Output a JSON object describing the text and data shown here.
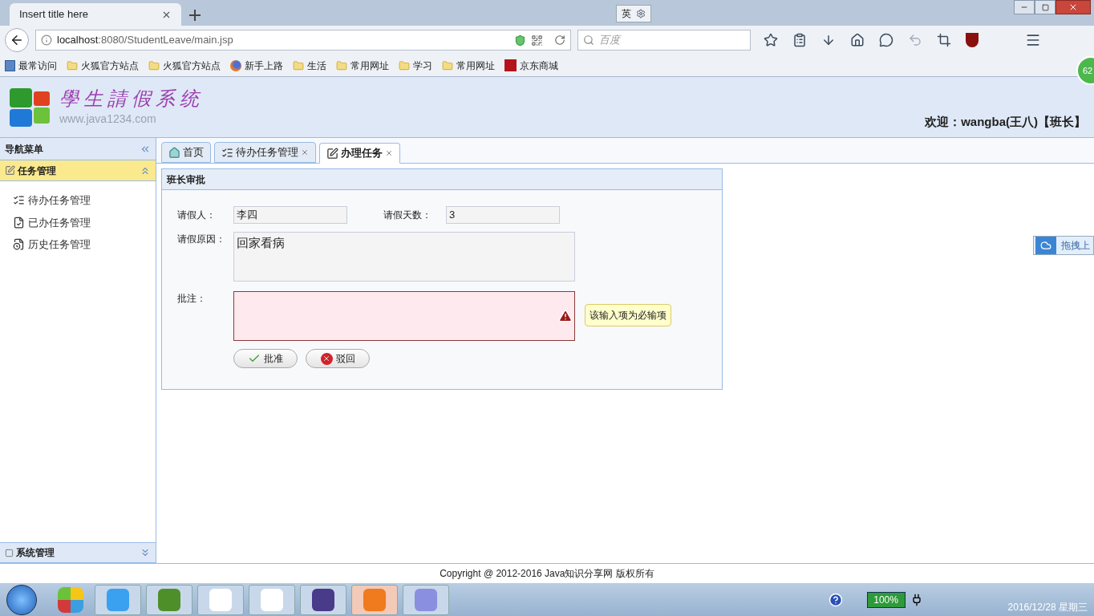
{
  "browser": {
    "tab_title": "Insert title here",
    "url_host": "localhost",
    "url_path": ":8080/StudentLeave/main.jsp",
    "search_placeholder": "百度",
    "ime_label": "英",
    "badge": "62",
    "bookmarks": [
      {
        "label": "最常访问",
        "kind": "page"
      },
      {
        "label": "火狐官方站点",
        "kind": "folder"
      },
      {
        "label": "火狐官方站点",
        "kind": "folder"
      },
      {
        "label": "新手上路",
        "kind": "firefox"
      },
      {
        "label": "生活",
        "kind": "folder"
      },
      {
        "label": "常用网址",
        "kind": "folder"
      },
      {
        "label": "学习",
        "kind": "folder"
      },
      {
        "label": "常用网址",
        "kind": "folder"
      },
      {
        "label": "京东商城",
        "kind": "jd"
      }
    ]
  },
  "header": {
    "logo_title": "學生請假系统",
    "logo_url": "www.java1234.com",
    "welcome": "欢迎：wangba(王八)【班长】"
  },
  "sidebar": {
    "title": "导航菜单",
    "sections": [
      {
        "title": "任务管理",
        "expanded": true,
        "items": [
          {
            "label": "待办任务管理",
            "kind": "list"
          },
          {
            "label": "已办任务管理",
            "kind": "done"
          },
          {
            "label": "历史任务管理",
            "kind": "history"
          }
        ]
      },
      {
        "title": "系统管理",
        "expanded": false
      }
    ]
  },
  "tabs": [
    {
      "label": "首页",
      "kind": "home",
      "selected": false,
      "closable": false
    },
    {
      "label": "待办任务管理",
      "kind": "list",
      "selected": false,
      "closable": true
    },
    {
      "label": "办理任务",
      "kind": "task",
      "selected": true,
      "closable": true
    }
  ],
  "panel": {
    "title": "班长审批",
    "applicant": {
      "label": "请假人：",
      "value": "李四"
    },
    "days": {
      "label": "请假天数：",
      "value": "3"
    },
    "reason": {
      "label": "请假原因：",
      "value": "回家看病"
    },
    "comment": {
      "label": "批注：",
      "invalid": true,
      "tooltip": "该输入项为必输项"
    },
    "buttons": [
      {
        "label": "批准",
        "kind": "approve"
      },
      {
        "label": "驳回",
        "kind": "reject"
      }
    ]
  },
  "side_widget": "拖拽上",
  "footer": "Copyright @ 2012-2016 Java知识分享网 版权所有",
  "taskbar": {
    "battery": "100%",
    "date": "2016/12/28 星期三"
  }
}
